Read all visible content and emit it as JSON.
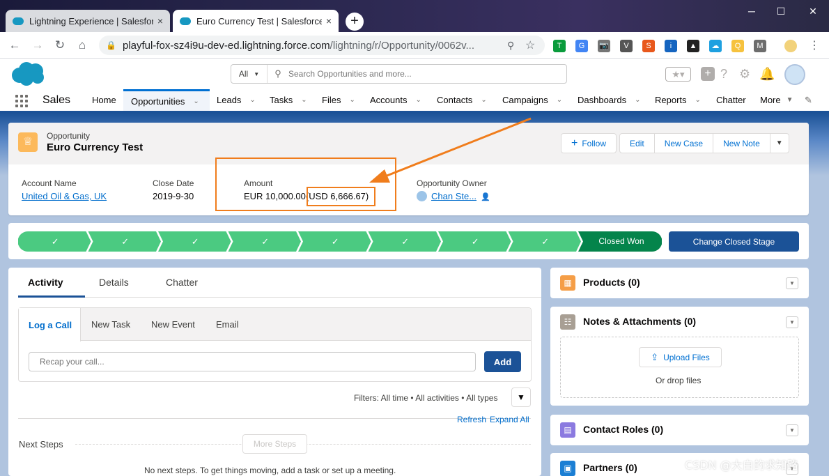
{
  "browser": {
    "tabs": [
      {
        "title": "Lightning Experience | Salesforce",
        "close": "×"
      },
      {
        "title": "Euro Currency Test | Salesforce",
        "close": "×"
      }
    ],
    "new_tab": "+",
    "window_controls": {
      "minimize": "─",
      "maximize": "☐",
      "close": "✕"
    },
    "url_host": "playful-fox-sz4i9u-dev-ed.lightning.force.com",
    "url_path": "/lightning/r/Opportunity/0062v...",
    "extensions": [
      "T",
      "G",
      "📷",
      "V",
      "S",
      "i",
      "▲",
      "☁",
      "Q",
      "M"
    ],
    "extension_colors": [
      "#0a9b3c",
      "#4285f4",
      "#757575",
      "#555555",
      "#e8581c",
      "#1565c0",
      "#222222",
      "#1ea0e0",
      "#f6c23e",
      "#6d6d6d"
    ]
  },
  "sf_header": {
    "search_scope": "All",
    "search_placeholder": "Search Opportunities and more..."
  },
  "nav": {
    "app_name": "Sales",
    "items": [
      "Home",
      "Opportunities",
      "Leads",
      "Tasks",
      "Files",
      "Accounts",
      "Contacts",
      "Campaigns",
      "Dashboards",
      "Reports",
      "Chatter",
      "More"
    ]
  },
  "record": {
    "type": "Opportunity",
    "name": "Euro Currency Test",
    "buttons": {
      "follow": "Follow",
      "edit": "Edit",
      "new_case": "New Case",
      "new_note": "New Note"
    },
    "fields": {
      "account_name_label": "Account Name",
      "account_name": "United Oil & Gas, UK",
      "close_date_label": "Close Date",
      "close_date": "2019-9-30",
      "amount_label": "Amount",
      "amount": "EUR 10,000.00",
      "amount_converted": "(USD 6,666.67)",
      "owner_label": "Opportunity Owner",
      "owner": "Chan Ste..."
    }
  },
  "path": {
    "completed_steps": 8,
    "current_stage": "Closed Won",
    "cta": "Change Closed Stage",
    "colors": {
      "complete": "#4bca81",
      "current": "#04844b"
    }
  },
  "activity": {
    "tabs": [
      "Activity",
      "Details",
      "Chatter"
    ],
    "composer_tabs": [
      "Log a Call",
      "New Task",
      "New Event",
      "Email"
    ],
    "recap_placeholder": "Recap your call...",
    "add": "Add",
    "filters": "Filters: All time • All activities • All types",
    "refresh": "Refresh",
    "expand_all": "Expand All",
    "next_steps": "Next Steps",
    "more_steps": "More Steps",
    "no_next_steps": "No next steps. To get things moving, add a task or set up a meeting."
  },
  "related": {
    "products": "Products (0)",
    "notes": "Notes & Attachments (0)",
    "upload_files": "Upload Files",
    "or_drop": "Or drop files",
    "contact_roles": "Contact Roles (0)",
    "partners": "Partners (0)"
  },
  "watermark": "CSDN @大白的求知路",
  "colors": {
    "brand": "#1b5297",
    "link": "#006dcc",
    "annotation": "#f07d1c"
  }
}
